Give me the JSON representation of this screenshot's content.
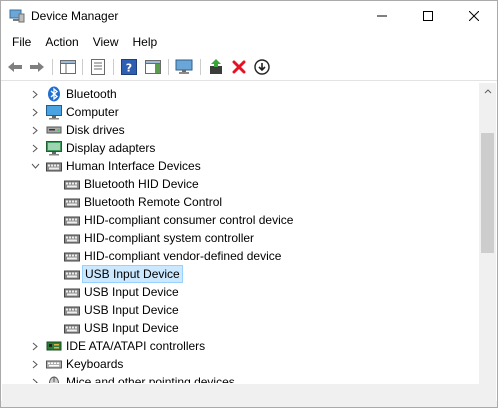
{
  "window": {
    "title": "Device Manager"
  },
  "menu": {
    "file": "File",
    "action": "Action",
    "view": "View",
    "help": "Help"
  },
  "toolbar": {
    "icons": [
      "back-icon",
      "forward-icon",
      "show-hide-console-tree-icon",
      "properties-icon",
      "help-icon",
      "action-pane-icon",
      "monitor-icon",
      "update-driver-icon",
      "uninstall-device-icon",
      "disable-device-icon"
    ]
  },
  "tree": {
    "categories": [
      {
        "label": "Bluetooth",
        "icon": "bluetooth-icon",
        "expanded": false
      },
      {
        "label": "Computer",
        "icon": "computer-icon",
        "expanded": false
      },
      {
        "label": "Disk drives",
        "icon": "disk-drive-icon",
        "expanded": false
      },
      {
        "label": "Display adapters",
        "icon": "display-adapter-icon",
        "expanded": false
      },
      {
        "label": "Human Interface Devices",
        "icon": "hid-icon",
        "expanded": true
      },
      {
        "label": "IDE ATA/ATAPI controllers",
        "icon": "ide-controller-icon",
        "expanded": false
      },
      {
        "label": "Keyboards",
        "icon": "keyboard-icon",
        "expanded": false
      },
      {
        "label": "Mice and other pointing devices",
        "icon": "mouse-icon",
        "expanded": false
      }
    ],
    "hid_children": [
      {
        "label": "Bluetooth HID Device",
        "selected": false
      },
      {
        "label": "Bluetooth Remote Control",
        "selected": false
      },
      {
        "label": "HID-compliant consumer control device",
        "selected": false
      },
      {
        "label": "HID-compliant system controller",
        "selected": false
      },
      {
        "label": "HID-compliant vendor-defined device",
        "selected": false
      },
      {
        "label": "USB Input Device",
        "selected": true
      },
      {
        "label": "USB Input Device",
        "selected": false
      },
      {
        "label": "USB Input Device",
        "selected": false
      },
      {
        "label": "USB Input Device",
        "selected": false
      }
    ]
  },
  "colors": {
    "selection_bg": "#cce8ff",
    "selection_border": "#99d1ff",
    "uninstall_red": "#e81123"
  }
}
